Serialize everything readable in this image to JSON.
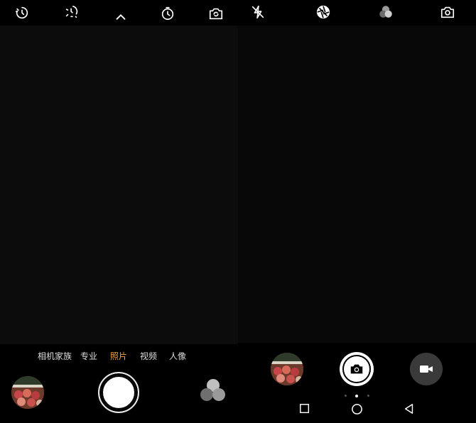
{
  "left": {
    "top_icons": [
      "timer-icon",
      "timer-off-icon",
      "collapse-arrow-icon",
      "timer-icon",
      "switch-camera-icon"
    ],
    "modes": [
      {
        "label": "相机家族",
        "active": false
      },
      {
        "label": "专业",
        "active": false
      },
      {
        "label": "照片",
        "active": true
      },
      {
        "label": "视频",
        "active": false
      },
      {
        "label": "人像",
        "active": false
      }
    ],
    "bottom_icons": {
      "gallery": "gallery-thumbnail",
      "shutter": "shutter-button",
      "filters": "filters-icon"
    }
  },
  "right": {
    "top_icons": [
      "flash-off-icon",
      "aperture-icon",
      "filters-icon",
      "switch-camera-icon"
    ],
    "bottom_icons": {
      "gallery": "gallery-thumbnail",
      "photo_mode": "camera-icon",
      "video_mode": "video-camera-icon"
    },
    "page_indicator": {
      "count": 3,
      "active": 1
    },
    "nav": [
      "square-icon",
      "circle-icon",
      "triangle-back-icon"
    ]
  },
  "colors": {
    "background": "#000000",
    "active_mode": "#f2a23a",
    "mode_text": "#dddddd"
  }
}
